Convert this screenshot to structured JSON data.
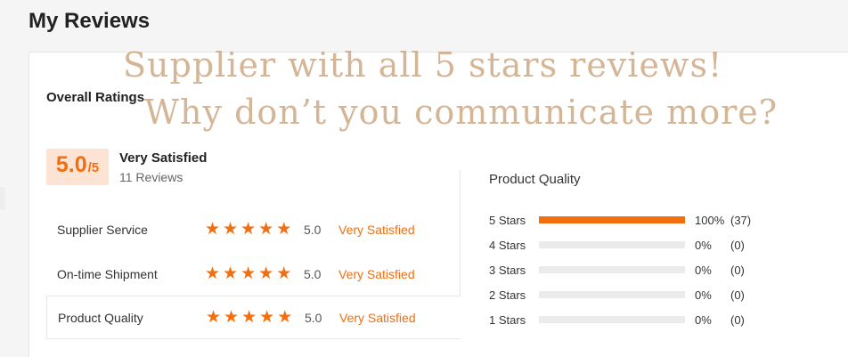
{
  "page": {
    "title": "My Reviews"
  },
  "overall": {
    "heading": "Overall Ratings",
    "score": "5.0",
    "score_max": "/5",
    "satisfaction": "Very Satisfied",
    "review_count": "11 Reviews"
  },
  "ratings": [
    {
      "label": "Supplier Service",
      "stars": 5,
      "score": "5.0",
      "text": "Very Satisfied"
    },
    {
      "label": "On-time Shipment",
      "stars": 5,
      "score": "5.0",
      "text": "Very Satisfied"
    },
    {
      "label": "Product Quality",
      "stars": 5,
      "score": "5.0",
      "text": "Very Satisfied"
    }
  ],
  "product_quality": {
    "heading": "Product Quality",
    "bars": [
      {
        "label": "5  Stars",
        "fraction": 1.0,
        "percent": "100%",
        "count": "(37)"
      },
      {
        "label": "4  Stars",
        "fraction": 0.0,
        "percent": "0%",
        "count": "(0)"
      },
      {
        "label": "3  Stars",
        "fraction": 0.0,
        "percent": "0%",
        "count": "(0)"
      },
      {
        "label": "2  Stars",
        "fraction": 0.0,
        "percent": "0%",
        "count": "(0)"
      },
      {
        "label": "1  Stars",
        "fraction": 0.0,
        "percent": "0%",
        "count": "(0)"
      }
    ]
  },
  "watermark": {
    "line1": "Supplier with all 5 stars reviews!",
    "line2": "Why don’t you communicate more?"
  },
  "colors": {
    "accent": "#f26e0f",
    "score_bg": "#fde3d3",
    "track": "#ebebeb"
  }
}
